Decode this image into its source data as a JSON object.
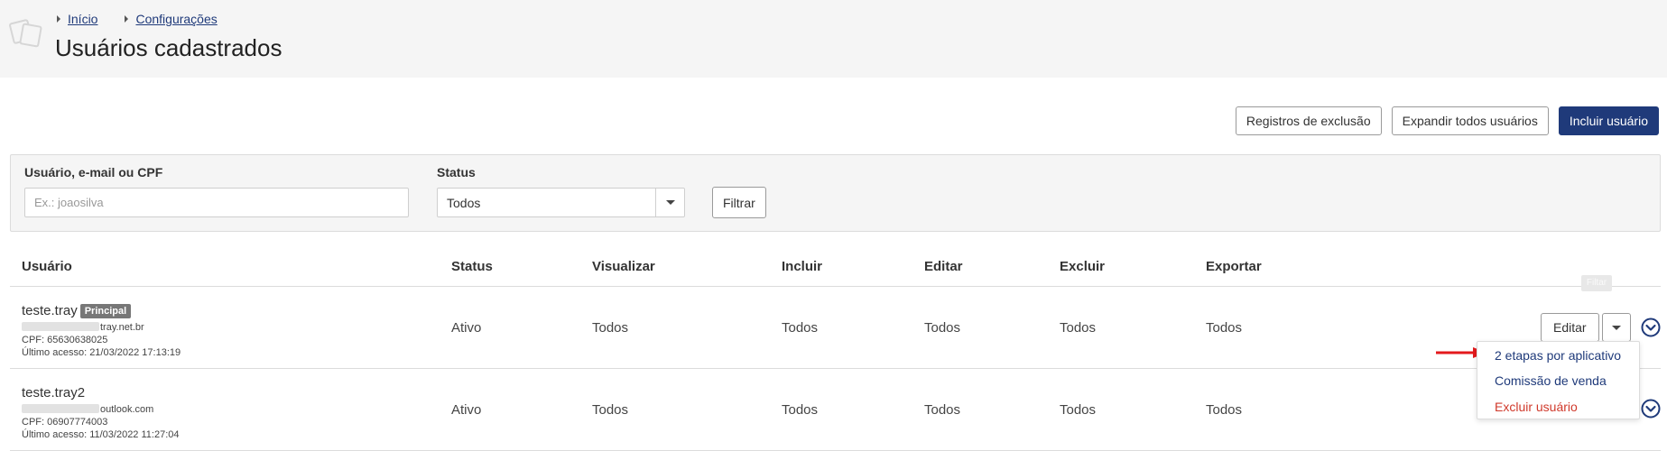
{
  "breadcrumb": [
    {
      "label": "Início"
    },
    {
      "label": "Configurações"
    }
  ],
  "page": {
    "title": "Usuários cadastrados"
  },
  "actions": {
    "deletion_logs": "Registros de exclusão",
    "expand_all": "Expandir todos usuários",
    "add_user": "Incluir usuário"
  },
  "filter": {
    "user_label": "Usuário, e-mail ou CPF",
    "user_placeholder": "Ex.: joaosilva",
    "status_label": "Status",
    "status_value": "Todos",
    "filter_button": "Filtrar"
  },
  "table": {
    "headers": {
      "user": "Usuário",
      "status": "Status",
      "view": "Visualizar",
      "include": "Incluir",
      "edit": "Editar",
      "delete": "Excluir",
      "export": "Exportar"
    },
    "rows": [
      {
        "name": "teste.tray",
        "badge": "Principal",
        "email_domain": "tray.net.br",
        "cpf": "CPF: 65630638025",
        "last_access": "Último acesso: 21/03/2022 17:13:19",
        "status": "Ativo",
        "view": "Todos",
        "include": "Todos",
        "edit": "Todos",
        "delete": "Todos",
        "export": "Todos",
        "edit_button": "Editar"
      },
      {
        "name": "teste.tray2",
        "email_domain": "outlook.com",
        "cpf": "CPF: 06907774003",
        "last_access": "Último acesso: 11/03/2022 11:27:04",
        "status": "Ativo",
        "view": "Todos",
        "include": "Todos",
        "edit": "Todos",
        "delete": "Todos",
        "export": "Todos"
      }
    ]
  },
  "ghost_label": "Filtar",
  "dropdown": {
    "items": [
      {
        "label": "2 etapas por aplicativo"
      },
      {
        "label": "Comissão de venda"
      },
      {
        "label": "Excluir usuário"
      }
    ]
  },
  "colors": {
    "primary": "#1f3a7a",
    "danger": "#d0392b",
    "annotation_arrow": "#e3191c"
  }
}
